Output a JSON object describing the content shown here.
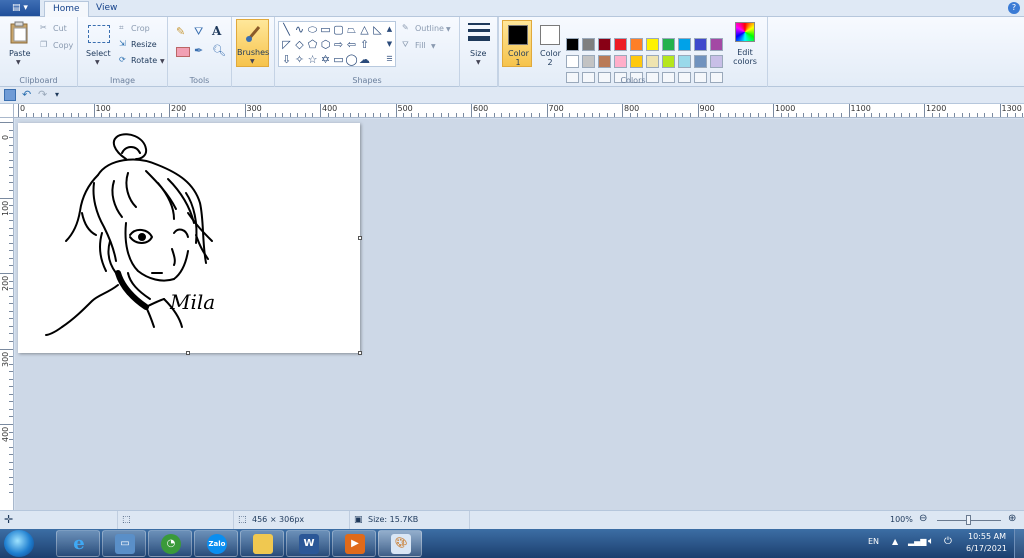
{
  "ribbon": {
    "tabs": [
      "Home",
      "View"
    ],
    "clipboard": {
      "paste": "Paste",
      "cut": "Cut",
      "copy": "Copy",
      "label": "Clipboard"
    },
    "image": {
      "select": "Select",
      "crop": "Crop",
      "resize": "Resize",
      "rotate": "Rotate",
      "label": "Image"
    },
    "tools": {
      "label": "Tools"
    },
    "brushes": {
      "label": "Brushes"
    },
    "shapes": {
      "outline": "Outline",
      "fill": "Fill",
      "label": "Shapes"
    },
    "size": {
      "label": "Size"
    },
    "colors": {
      "color1": "Color 1",
      "color2": "Color 2",
      "color1_value": "#000000",
      "color2_value": "#ffffff",
      "edit": "Edit colors",
      "label": "Colors",
      "palette_row1": [
        "#000000",
        "#7f7f7f",
        "#880015",
        "#ed1c24",
        "#ff7f27",
        "#fff200",
        "#22b14c",
        "#00a2e8",
        "#3f48cc",
        "#a349a4"
      ],
      "palette_row2": [
        "#ffffff",
        "#c3c3c3",
        "#b97a57",
        "#ffaec9",
        "#ffc90e",
        "#efe4b0",
        "#b5e61d",
        "#99d9ea",
        "#7092be",
        "#c8bfe7"
      ]
    }
  },
  "ruler": {
    "h_labels": [
      "0",
      "100",
      "200",
      "300",
      "400",
      "500",
      "600",
      "700",
      "800",
      "900",
      "1000",
      "1100",
      "1200",
      "1300"
    ],
    "v_labels": [
      "0",
      "100",
      "200",
      "300",
      "400"
    ]
  },
  "canvas": {
    "signature": "Mila"
  },
  "status": {
    "selection_size": "456 × 306px",
    "file_size": "Size: 15.7KB",
    "zoom": "100%"
  },
  "taskbar": {
    "apps": [
      "Internet Explorer",
      "Remote Desktop",
      "CocCoc",
      "Zalo",
      "Windows Explorer",
      "Word",
      "Media",
      "Paint"
    ],
    "zalo_label": "Zalo",
    "word_label": "W",
    "lang": "EN",
    "time": "10:55 AM",
    "date": "6/17/2021"
  }
}
